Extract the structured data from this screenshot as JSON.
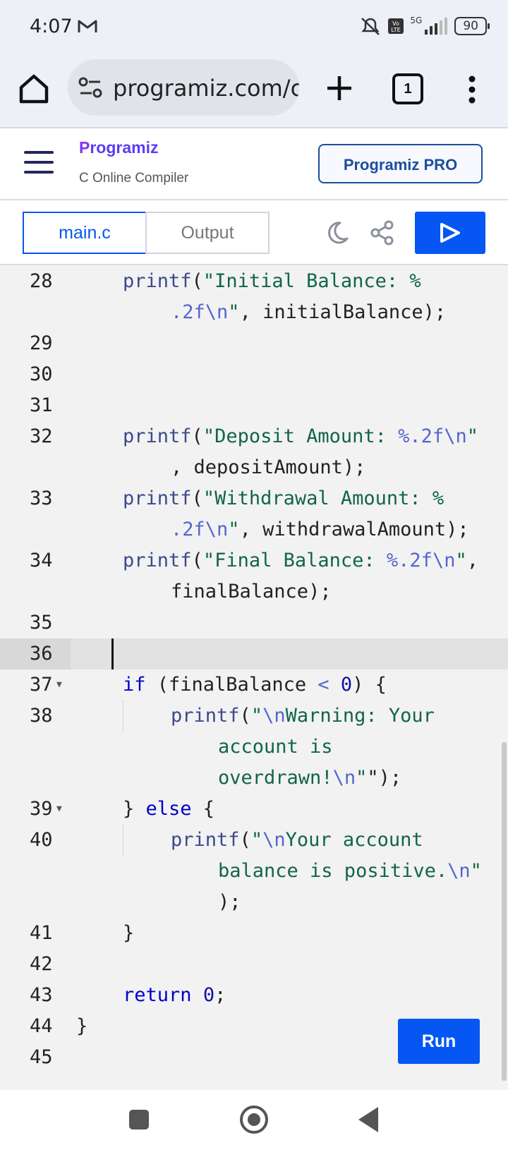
{
  "status_bar": {
    "time": "4:07",
    "battery": "90",
    "network": "5G"
  },
  "browser": {
    "url": "programiz.com/c·",
    "tab_count": "1"
  },
  "header": {
    "logo_p": "P",
    "logo_rest": "rogramiz",
    "subtitle": "C Online Compiler",
    "pro_button": "Programiz PRO"
  },
  "toolbar": {
    "tab_main": "main.c",
    "tab_output": "Output"
  },
  "editor": {
    "line_numbers": [
      "28",
      "29",
      "30",
      "31",
      "32",
      "33",
      "34",
      "35",
      "36",
      "37",
      "38",
      "39",
      "40",
      "41",
      "42",
      "43",
      "44",
      "45"
    ],
    "code": {
      "l28a_fn": "printf",
      "l28a_str": "\"Initial Balance: %",
      "l28b_fmt": ".2f",
      "l28b_esc": "\\n",
      "l28b_rest": ", initialBalance);",
      "l32a_fn": "printf",
      "l32a_str1": "\"Deposit Amount: ",
      "l32a_fmt": "%.2f",
      "l32a_esc": "\\n",
      "l32b_rest": ", depositAmount);",
      "l33a_fn": "printf",
      "l33a_str": "\"Withdrawal Amount: %",
      "l33b_fmt": ".2f",
      "l33b_esc": "\\n",
      "l33b_rest": ", withdrawalAmount);",
      "l34a_fn": "printf",
      "l34a_str1": "\"Final Balance: ",
      "l34a_fmt": "%.2f",
      "l34a_esc": "\\n",
      "l34b_rest": "finalBalance);",
      "l37_kw": "if",
      "l37_var": " (finalBalance ",
      "l37_op": "<",
      "l37_num": "0",
      "l37_rest": ") {",
      "l38a_fn": "printf",
      "l38a_esc": "\\n",
      "l38a_str": "Warning: Your",
      "l38b_str": "account is",
      "l38c_str": "overdrawn!",
      "l38c_esc": "\\n",
      "l38c_rest": "\");",
      "l39_open": "} ",
      "l39_kw": "else",
      "l39_rest": " {",
      "l40a_fn": "printf",
      "l40a_esc": "\\n",
      "l40a_str": "Your account",
      "l40b_str": "balance is positive.",
      "l40b_esc": "\\n",
      "l40c_rest": ");",
      "l41": "}",
      "l43_kw": "return",
      "l43_num": "0",
      "l44": "}"
    }
  },
  "run_button": "Run"
}
